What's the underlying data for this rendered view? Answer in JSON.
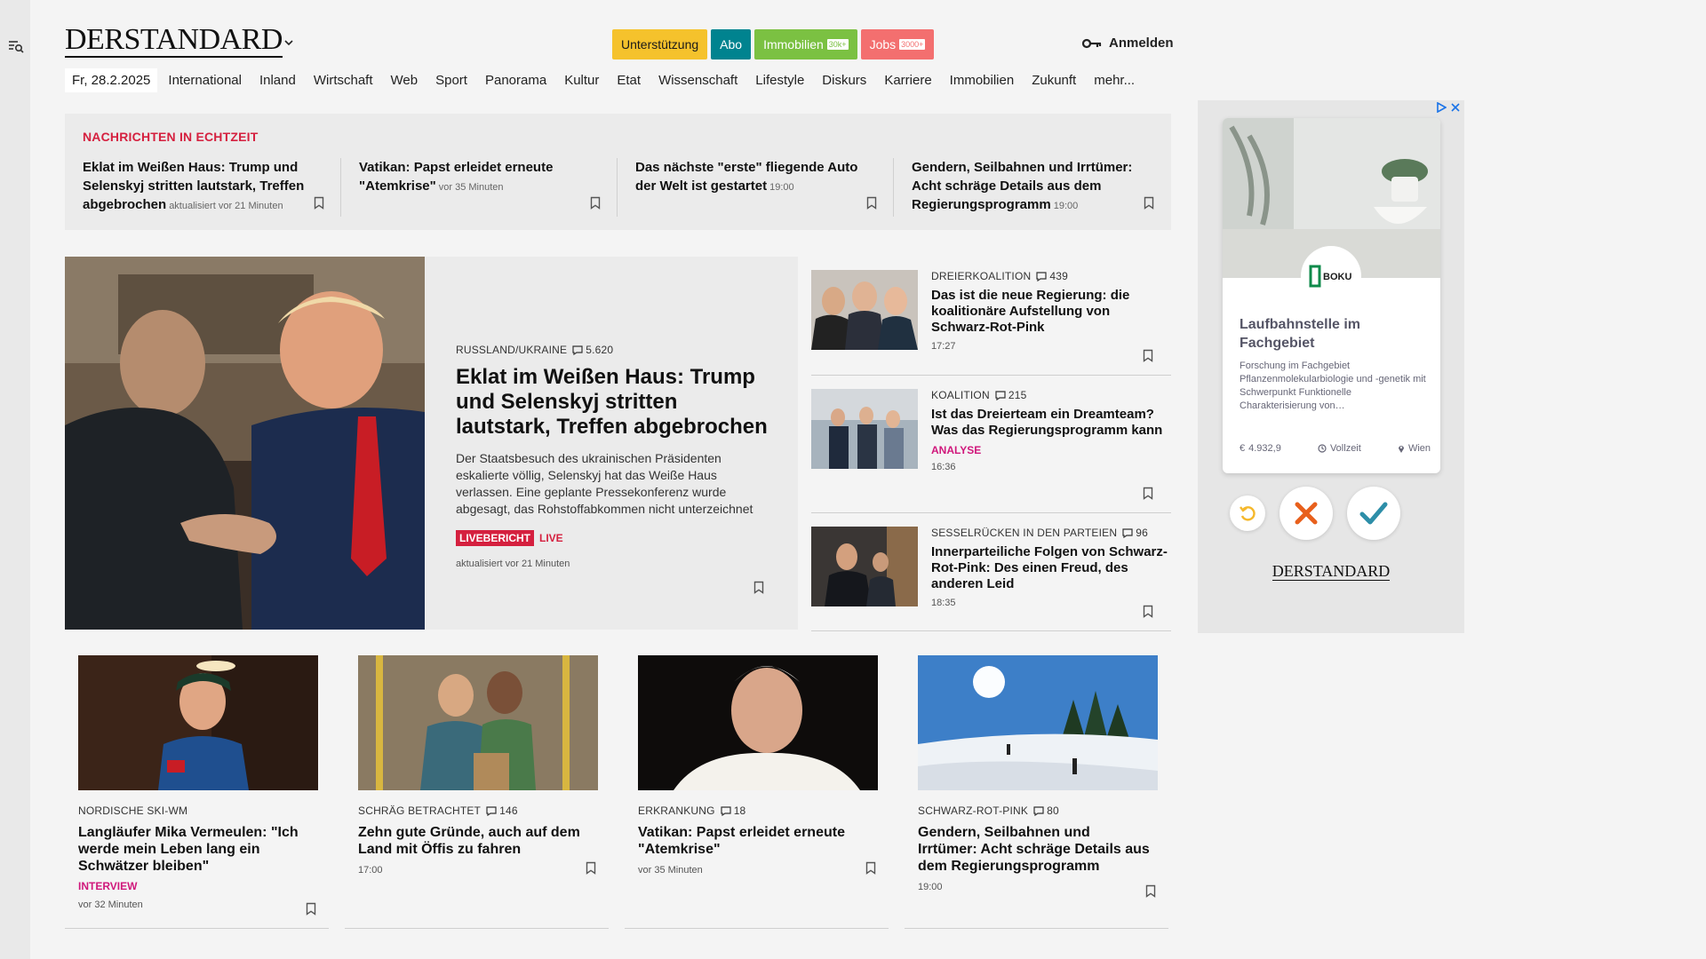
{
  "header": {
    "logo": "DERSTANDARD",
    "promo": [
      {
        "label": "Unterstützung",
        "tag": ""
      },
      {
        "label": "Abo",
        "tag": ""
      },
      {
        "label": "Immobilien",
        "tag": "30k+"
      },
      {
        "label": "Jobs",
        "tag": "3000+"
      }
    ],
    "login_label": "Anmelden"
  },
  "nav": {
    "date": "Fr, 28.2.2025",
    "items": [
      "International",
      "Inland",
      "Wirtschaft",
      "Web",
      "Sport",
      "Panorama",
      "Kultur",
      "Etat",
      "Wissenschaft",
      "Lifestyle",
      "Diskurs",
      "Karriere",
      "Immobilien",
      "Zukunft",
      "mehr..."
    ]
  },
  "realtime": {
    "title": "NACHRICHTEN IN ECHTZEIT",
    "items": [
      {
        "title": "Eklat im Weißen Haus: Trump und Selenskyj stritten lautstark, Treffen abgebrochen",
        "time": "aktualisiert vor 21 Minuten"
      },
      {
        "title": "Vatikan: Papst erleidet erneute \"Atemkrise\"",
        "time": "vor 35 Minuten"
      },
      {
        "title": "Das nächste \"erste\" fliegende Auto der Welt ist gestartet",
        "time": "19:00"
      },
      {
        "title": "Gendern, Seilbahnen und Irrtümer: Acht schräge Details aus dem Regierungsprogramm",
        "time": "19:00"
      }
    ]
  },
  "hero": {
    "kicker": "RUSSLAND/UKRAINE",
    "comments": "5.620",
    "title": "Eklat im Weißen Haus: Trump und Selenskyj stritten lautstark, Treffen abgebrochen",
    "lead": "Der Staatsbesuch des ukrainischen Präsidenten eskalierte völlig, Selenskyj hat das Weiße Haus verlassen. Eine geplante Pressekonferenz wurde abgesagt, das Rohstoffabkommen nicht unterzeichnet",
    "badge_report": "LIVEBERICHT",
    "badge_live": "LIVE",
    "time": "aktualisiert vor 21 Minuten"
  },
  "side_stories": [
    {
      "kicker": "DREIERKOALITION",
      "comments": "439",
      "title": "Das ist die neue Regierung: die koalitionäre Aufstellung von Schwarz-Rot-Pink",
      "label": "",
      "time": "17:27"
    },
    {
      "kicker": "KOALITION",
      "comments": "215",
      "title": "Ist das Dreierteam ein Dreamteam? Was das Regierungsprogramm kann",
      "label": "ANALYSE",
      "time": "16:36"
    },
    {
      "kicker": "SESSELRÜCKEN IN DEN PARTEIEN",
      "comments": "96",
      "title": "Innerparteiliche Folgen von Schwarz-Rot-Pink: Des einen Freud, des anderen Leid",
      "label": "",
      "time": "18:35"
    }
  ],
  "bottom_stories": [
    {
      "kicker": "NORDISCHE SKI-WM",
      "comments": "",
      "title": "Langläufer Mika Vermeulen: \"Ich werde mein Leben lang ein Schwätzer bleiben\"",
      "label": "INTERVIEW",
      "time": "vor 32 Minuten"
    },
    {
      "kicker": "SCHRÄG BETRACHTET",
      "comments": "146",
      "title": "Zehn gute Gründe, auch auf dem Land mit Öffis zu fahren",
      "label": "",
      "time": "17:00"
    },
    {
      "kicker": "ERKRANKUNG",
      "comments": "18",
      "title": "Vatikan: Papst erleidet erneute \"Atemkrise\"",
      "label": "",
      "time": "vor 35 Minuten"
    },
    {
      "kicker": "SCHWARZ-ROT-PINK",
      "comments": "80",
      "title": "Gendern, Seilbahnen und Irrtümer: Acht schräge Details aus dem Regierungsprogramm",
      "label": "",
      "time": "19:00"
    }
  ],
  "ad": {
    "brand": "BOKU",
    "title": "Laufbahnstelle im Fachgebiet",
    "description": "Forschung im Fachgebiet Pflanzenmolekularbiologie und -genetik mit Schwerpunkt Funktionelle Charakterisierung von…",
    "salary": "4.932,9",
    "employment": "Vollzeit",
    "location": "Wien",
    "logo": "DERSTANDARD"
  },
  "colors": {
    "accent_red": "#d5203f",
    "label_pink": "#d0177b",
    "support": "#f5c22c",
    "abo": "#00838f",
    "immobilien": "#7bc142",
    "jobs": "#f36f6f"
  }
}
